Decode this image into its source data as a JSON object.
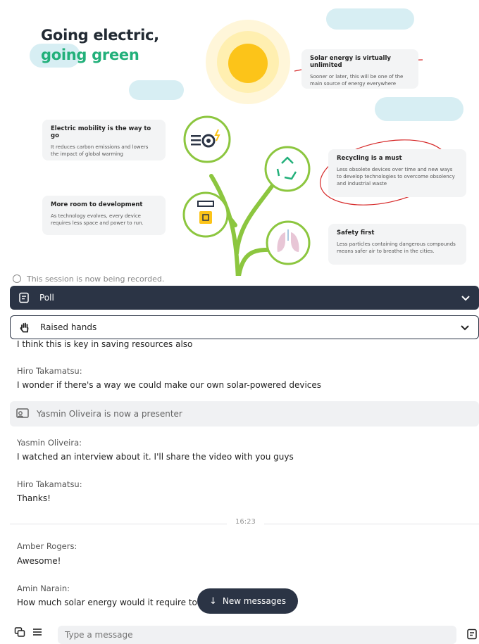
{
  "slide": {
    "title_line1": "Going electric,",
    "title_line2": "going green",
    "cards": [
      {
        "title": "Solar energy is virtually unlimited",
        "body": "Sooner or later, this will be one of the main source of energy everywhere"
      },
      {
        "title": "Electric mobility is the way to go",
        "body": "It reduces carbon emissions and lowers the impact of global warming"
      },
      {
        "title": "Recycling is a must",
        "body": "Less obsolete devices over time and new ways to develop technologies to overcome obsolency and industrial waste"
      },
      {
        "title": "More room to development",
        "body": "As technology evolves, every device requires less space and power to run."
      },
      {
        "title": "Safety first",
        "body": "Less particles containing dangerous compounds means safer air to breathe in the cities."
      }
    ]
  },
  "chat": {
    "recording_notice": "This session is now being recorded.",
    "poll_label": "Poll",
    "raised_hands_label": "Raised hands",
    "partial_message": "I think this is key in saving resources also",
    "messages": [
      {
        "sender": "Hiro Takamatsu:",
        "text": "I wonder if there's a way we could make our own solar-powered devices"
      },
      {
        "sender": "Yasmin Oliveira:",
        "text": "I watched an interview about it. I'll share the video with you guys"
      },
      {
        "sender": "Hiro Takamatsu:",
        "text": "Thanks!"
      },
      {
        "sender": "Amber Rogers:",
        "text": "Awesome!"
      },
      {
        "sender": "Amin Narain:",
        "text": "How much solar energy would it require to r"
      }
    ],
    "presenter_notice": "Yasmin Oliveira is now a presenter",
    "time_divider": "16:23",
    "new_messages_label": "New messages",
    "input_placeholder": "Type a message"
  },
  "colors": {
    "dark_navy": "#2b3445",
    "green": "#22b07a",
    "sun": "#fcc419",
    "stem": "#8cc63f"
  },
  "icons": {
    "poll": "poll-icon",
    "hand": "hand-icon",
    "chevron": "chevron-down-icon",
    "presenter": "presenter-icon",
    "arrow_down": "arrow-down-icon",
    "send": "send-icon"
  }
}
